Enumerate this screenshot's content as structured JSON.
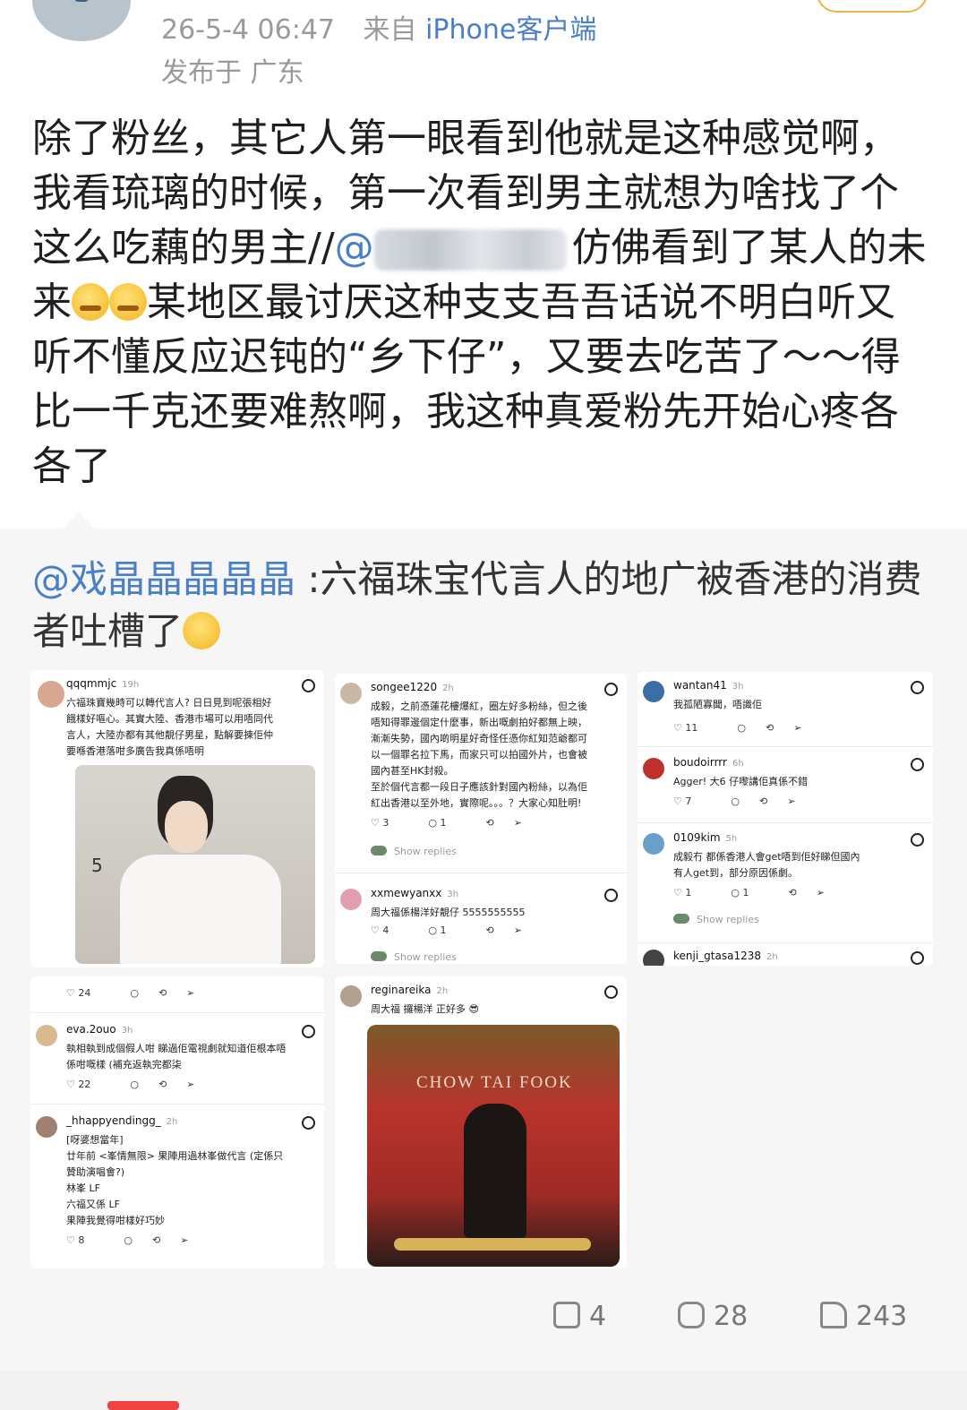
{
  "post": {
    "time": "26-5-4 06:47",
    "source_prefix": "来自",
    "client": "iPhone客户端",
    "location": "发布于 广东",
    "body_part1": "除了粉丝，其它人第一眼看到他就是这种感觉啊，我看琉璃的时候，第一次看到男主就想为啥找了个这么吃藕的男主//",
    "body_mention": "@",
    "body_part2": "仿佛看到了某人的未来",
    "body_part3": "某地区最讨厌这种支支吾吾话说不明白听又听不懂反应迟钝的“乡下仔”，又要去吃苦了～～得比一千克还要难熬啊，我这种真爱粉先开始心疼各各了"
  },
  "repost": {
    "mention": "@戏晶晶晶晶晶",
    "text": ":六福珠宝代言人的地广被香港的消费者吐槽了"
  },
  "threads": {
    "c1": {
      "user": "qqqmmjc",
      "ago": "19h",
      "text": "六福珠寶幾時可以轉代言人? 日日見到呢張相好\n餓樣好嘔心。其實大陸、香港市場可以用唔同代\n言人，大陸亦都有其他靚仔男星，點解要揀佢仲\n要喺香港落咁多廣告我真係唔明"
    },
    "c1_photo_mark": "5",
    "c1_acts": {
      "likes": "24"
    },
    "c2": {
      "user": "songee1220",
      "ago": "2h",
      "text": "成毅，之前憑蓮花樓爆紅，圈左好多粉絲，但之後\n唔知得罪邊個定什麼事，新出嘅劇拍好都無上映，\n漸漸失勢，國內啲明星好奇怪任憑你紅知范爺都可\n以一個罪名拉下馬，而家只可以拍國外片，也會被\n國內甚至HK封殺。\n至於個代言都一段日子應該針對國內粉絲，以為佢\n紅出香港以至外地，實際呢。。。？大家心知肚明!"
    },
    "c2_acts": {
      "likes": "3",
      "replies": "1",
      "show": "Show replies"
    },
    "c3": {
      "user": "xxmewyanxx",
      "ago": "3h",
      "text": "周大福係楊洋好靚仔 5555555555"
    },
    "c3_acts": {
      "likes": "4",
      "replies": "1",
      "show": "Show replies"
    },
    "c4": {
      "user": "wantan41",
      "ago": "3h",
      "text": "我孤陋寡聞，唔識佢"
    },
    "c4_acts": {
      "likes": "11"
    },
    "c5": {
      "user": "boudoirrrr",
      "ago": "6h",
      "text": "Agger! 大6 仔嚟講佢真係不錯"
    },
    "c5_acts": {
      "likes": "7"
    },
    "c6": {
      "user": "0109kim",
      "ago": "5h",
      "text": "成毅冇  都係香港人會get唔到佢好睇但國內\n有人get到，部分原因係劇。"
    },
    "c6_acts": {
      "likes": "1",
      "replies": "1",
      "show": "Show replies"
    },
    "c7": {
      "user": "kenji_gtasa1238",
      "ago": "2h"
    },
    "c8": {
      "user": "eva.2ouo",
      "ago": "3h",
      "text": "執相執到成個假人咁  睇過佢電視劇就知道佢根本唔\n係咁嘅樣 (補充返執完都柒"
    },
    "c8_acts": {
      "likes": "22"
    },
    "c9": {
      "user": "_hhappyendingg_",
      "ago": "2h",
      "text": "[呀婆想當年]\n廿年前 <峯情無限> 果陣用過林峯做代言 (定係只\n贊助演唱會?)\n林峯 LF\n六福又係 LF\n果陣我覺得咁樣好巧妙"
    },
    "c9_acts": {
      "likes": "8"
    },
    "c10": {
      "user": "reginareika",
      "ago": "2h",
      "text": "周大福 攞楊洋 正好多 😎"
    },
    "photo2_brand": "CHOW TAI FOOK"
  },
  "actions": {
    "share": "4",
    "comments": "28",
    "likes": "243"
  }
}
